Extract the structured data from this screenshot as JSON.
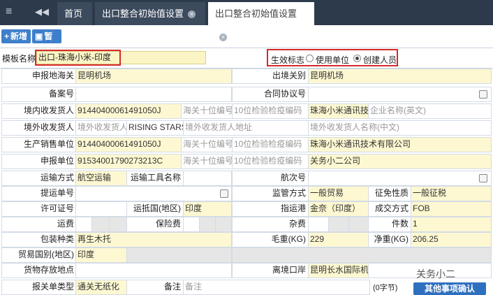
{
  "nav": {
    "home_tab": "首页",
    "tab1": "出口整合初始值设置",
    "tab2": "出口整合初始值设置",
    "close_glyph": "×"
  },
  "toolbar": {
    "add_label": "新增",
    "save_label": "暂存"
  },
  "template": {
    "label": "模板名称",
    "value": "出口-珠海小米-印度",
    "effective_label": "生效标志",
    "options": [
      "使用单位",
      "创建人员"
    ]
  },
  "fields": {
    "declare_customs_label": "申报地海关",
    "declare_customs": "昆明机场",
    "exit_customs_label": "出境关别",
    "exit_customs": "昆明机场",
    "record_no_label": "备案号",
    "contract_no_label": "合同协议号",
    "consignee_label": "境内收发货人",
    "consignee_code": "91440400061491050J",
    "customs_10_ph": "海关十位编号",
    "inspection_10_ph": "10位检验检疫编码",
    "consignee_name": "珠海小米通讯技",
    "consignee_en_ph": "企业名称(英文)",
    "overseas_label": "境外收发货人",
    "overseas_code_ph": "境外收发货人",
    "overseas_name": "RISING STARS",
    "overseas_addr_ph": "境外收发货人地址",
    "overseas_cn_ph": "境外收发货人名称(中文)",
    "producer_label": "生产销售单位",
    "producer_code": "91440400061491050J",
    "producer_name": "珠海小米通讯技术有限公司",
    "declarer_label": "申报单位",
    "declarer_code": "91534001790273213C",
    "declarer_name": "关务小二公司",
    "transport_label": "运输方式",
    "transport": "航空运输",
    "tool_label": "运输工具名称",
    "voyage_label": "航次号",
    "bill_label": "提运单号",
    "supervision_label": "监管方式",
    "supervision": "一般贸易",
    "tax_label": "征免性质",
    "tax": "一般征税",
    "license_label": "许可证号",
    "dest_country_label": "运抵国(地区)",
    "dest_country": "印度",
    "port_label": "指运港",
    "port": "金奈（印度）",
    "deal_label": "成交方式",
    "deal": "FOB",
    "freight_label": "运费",
    "insurance_label": "保险费",
    "misc_label": "杂费",
    "pieces_label": "件数",
    "pieces": "1",
    "package_label": "包装种类",
    "package": "再生木托",
    "gross_label": "毛重(KG)",
    "gross": "229",
    "net_label": "净重(KG)",
    "net": "206.25",
    "trade_country_label": "贸易国别(地区)",
    "trade_country": "印度",
    "storage_label": "货物存放地点",
    "depart_port_label": "离境口岸",
    "depart_port": "昆明长水国际机",
    "decl_type_label": "报关单类型",
    "decl_type": "通关无纸化",
    "remark_label": "备注",
    "remark_ph": "备注",
    "byte_count": "(0字节)",
    "other_confirm": "其他事项确认"
  },
  "watermark": "关务小二"
}
